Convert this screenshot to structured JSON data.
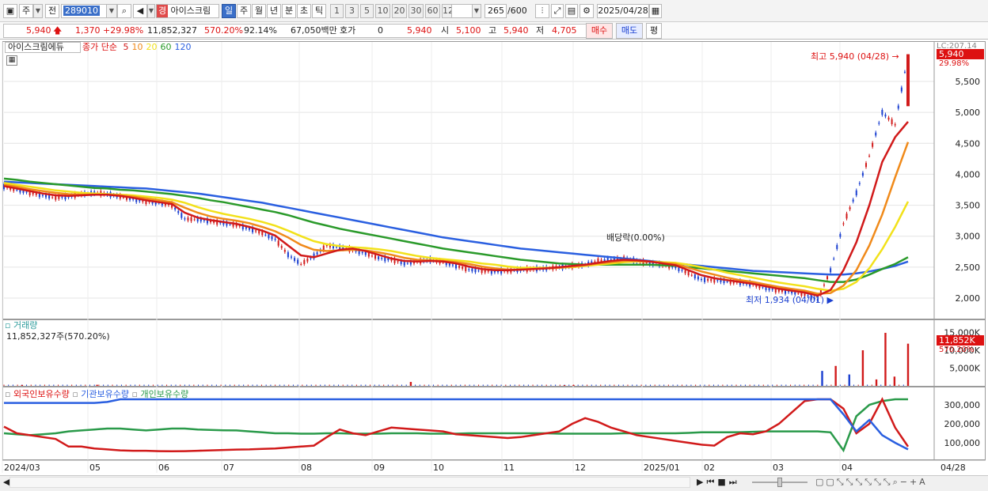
{
  "toolbar": {
    "period_type": "주",
    "compare_label": "전",
    "stock_code": "289010",
    "stock_badge": "경",
    "stock_name": "아이스크림",
    "periods": [
      "일",
      "주",
      "월",
      "년",
      "분",
      "초",
      "틱"
    ],
    "active_period": "일",
    "tick_intervals": [
      "1",
      "3",
      "5",
      "10",
      "20",
      "30",
      "60",
      "120"
    ],
    "count": "265",
    "total": "/600",
    "date": "2025/04/28"
  },
  "quote": {
    "price": "5,940",
    "change": "1,370",
    "change_pct": "+29.98%",
    "volume": "11,852,327",
    "volume_ratio": "570.20%",
    "ratio2": "92.14%",
    "amount": "67,050백만",
    "hoga_label": "호가",
    "hoga_value": "0",
    "hoga_price": "5,940",
    "open_label": "시",
    "open": "5,100",
    "high_label": "고",
    "high": "5,940",
    "low_label": "저",
    "low": "4,705",
    "buy_label": "매수",
    "sell_label": "매도",
    "eval_label": "평"
  },
  "price_panel": {
    "stock_label": "아이스크림에듀",
    "ma_label": "종가 단순",
    "ma_periods": [
      "5",
      "10",
      "20",
      "60",
      "120"
    ],
    "ma_colors": [
      "#d11a1a",
      "#f08a1a",
      "#f2e11a",
      "#2a9a2a",
      "#2a5fe0"
    ],
    "scale_top": "LC:207.14",
    "current_price": "5,940",
    "current_pct": "29.98%",
    "high_note": "최고 5,940 (04/28)",
    "low_note": "최저 1,934 (04/01)",
    "dividend_note": "배당락(0.00%)"
  },
  "volume_panel": {
    "title": "거래량",
    "value": "11,852,327주(570.20%)",
    "current": "11,852K",
    "current_pct": "570.20%"
  },
  "holder_panel": {
    "foreign": "외국인보유수량",
    "institution": "기관보유수량",
    "individual": "개인보유수량"
  },
  "colors": {
    "up": "#d11a1a",
    "down": "#1a3fd0",
    "foreign": "#d11a1a",
    "institution": "#2a5fe0",
    "individual": "#2a9a4a"
  },
  "chart_data": {
    "type": "line",
    "x_labels": [
      "2024/03",
      "05",
      "06",
      "07",
      "08",
      "09",
      "10",
      "11",
      "12",
      "2025/01",
      "02",
      "03",
      "04",
      "04/28"
    ],
    "price_axis": [
      "2,000",
      "2,500",
      "3,000",
      "3,500",
      "4,000",
      "4,500",
      "5,000",
      "5,500"
    ],
    "price_range": [
      1800,
      6200
    ],
    "volume_axis": [
      "5,000K",
      "10,000K",
      "15,000K"
    ],
    "volume_range": [
      0,
      16000
    ],
    "holder_axis": [
      "100,000",
      "200,000",
      "300,000"
    ],
    "holder_range": [
      50000,
      370000
    ],
    "close": [
      3800,
      3750,
      3700,
      3660,
      3620,
      3640,
      3680,
      3700,
      3680,
      3640,
      3600,
      3560,
      3540,
      3500,
      3280,
      3270,
      3240,
      3210,
      3180,
      3120,
      3050,
      2950,
      2700,
      2550,
      2680,
      2850,
      2820,
      2780,
      2720,
      2650,
      2620,
      2560,
      2590,
      2620,
      2580,
      2520,
      2460,
      2440,
      2430,
      2440,
      2460,
      2470,
      2480,
      2500,
      2520,
      2540,
      2600,
      2620,
      2640,
      2600,
      2560,
      2540,
      2500,
      2400,
      2300,
      2290,
      2270,
      2250,
      2220,
      2160,
      2120,
      2100,
      2060,
      1970,
      2450,
      3200,
      3700,
      4300,
      5000,
      4800,
      5940
    ],
    "ma5": [
      3810,
      3770,
      3730,
      3690,
      3660,
      3650,
      3660,
      3670,
      3670,
      3650,
      3620,
      3580,
      3550,
      3520,
      3380,
      3300,
      3260,
      3230,
      3200,
      3150,
      3090,
      3010,
      2850,
      2690,
      2660,
      2720,
      2780,
      2800,
      2760,
      2700,
      2640,
      2600,
      2590,
      2600,
      2590,
      2560,
      2510,
      2470,
      2450,
      2450,
      2460,
      2470,
      2480,
      2500,
      2520,
      2540,
      2570,
      2600,
      2620,
      2610,
      2590,
      2560,
      2530,
      2450,
      2370,
      2320,
      2290,
      2260,
      2230,
      2190,
      2150,
      2120,
      2090,
      2040,
      2130,
      2450,
      2900,
      3500,
      4200,
      4600,
      4850
    ],
    "ma10": [
      3830,
      3800,
      3760,
      3730,
      3700,
      3680,
      3670,
      3670,
      3670,
      3660,
      3640,
      3610,
      3580,
      3550,
      3460,
      3380,
      3320,
      3280,
      3250,
      3210,
      3150,
      3080,
      2980,
      2860,
      2780,
      2760,
      2770,
      2780,
      2770,
      2740,
      2700,
      2650,
      2620,
      2610,
      2600,
      2580,
      2550,
      2510,
      2480,
      2460,
      2460,
      2470,
      2480,
      2490,
      2510,
      2530,
      2560,
      2580,
      2600,
      2600,
      2590,
      2570,
      2550,
      2490,
      2430,
      2380,
      2330,
      2290,
      2260,
      2220,
      2180,
      2150,
      2120,
      2070,
      2080,
      2200,
      2450,
      2850,
      3350,
      3950,
      4520
    ],
    "ma20": [
      3860,
      3830,
      3800,
      3770,
      3740,
      3720,
      3700,
      3690,
      3680,
      3670,
      3660,
      3640,
      3620,
      3590,
      3540,
      3470,
      3410,
      3360,
      3320,
      3280,
      3230,
      3170,
      3090,
      3000,
      2920,
      2870,
      2840,
      2820,
      2810,
      2790,
      2760,
      2720,
      2680,
      2650,
      2630,
      2610,
      2590,
      2560,
      2540,
      2510,
      2490,
      2490,
      2490,
      2490,
      2500,
      2520,
      2540,
      2560,
      2580,
      2590,
      2590,
      2580,
      2570,
      2540,
      2500,
      2460,
      2410,
      2370,
      2330,
      2290,
      2250,
      2220,
      2190,
      2150,
      2120,
      2150,
      2260,
      2480,
      2790,
      3150,
      3560
    ],
    "ma60": [
      3930,
      3910,
      3880,
      3860,
      3840,
      3820,
      3800,
      3780,
      3770,
      3750,
      3740,
      3720,
      3700,
      3680,
      3650,
      3620,
      3580,
      3550,
      3510,
      3470,
      3430,
      3390,
      3340,
      3280,
      3220,
      3170,
      3120,
      3080,
      3040,
      3000,
      2960,
      2920,
      2880,
      2840,
      2800,
      2770,
      2740,
      2710,
      2680,
      2650,
      2620,
      2600,
      2580,
      2560,
      2550,
      2540,
      2540,
      2540,
      2540,
      2540,
      2540,
      2530,
      2520,
      2500,
      2480,
      2460,
      2440,
      2420,
      2400,
      2380,
      2360,
      2340,
      2320,
      2290,
      2260,
      2260,
      2300,
      2380,
      2470,
      2550,
      2660
    ],
    "ma120": [
      3880,
      3870,
      3860,
      3850,
      3840,
      3830,
      3820,
      3810,
      3800,
      3790,
      3780,
      3770,
      3750,
      3730,
      3710,
      3690,
      3660,
      3630,
      3600,
      3570,
      3540,
      3500,
      3460,
      3420,
      3380,
      3340,
      3300,
      3260,
      3220,
      3180,
      3140,
      3100,
      3060,
      3020,
      2980,
      2950,
      2920,
      2890,
      2860,
      2830,
      2800,
      2780,
      2760,
      2740,
      2720,
      2700,
      2680,
      2660,
      2640,
      2620,
      2600,
      2580,
      2560,
      2540,
      2520,
      2500,
      2480,
      2460,
      2440,
      2430,
      2420,
      2410,
      2400,
      2390,
      2380,
      2380,
      2400,
      2430,
      2470,
      2520,
      2590
    ],
    "volume_spikes": [
      {
        "i": 0.02,
        "v": 250
      },
      {
        "i": 0.103,
        "v": 300
      },
      {
        "i": 0.45,
        "v": 1100
      },
      {
        "i": 0.62,
        "v": 200
      },
      {
        "i": 0.63,
        "v": 250
      },
      {
        "i": 0.905,
        "v": 4200
      },
      {
        "i": 0.92,
        "v": 5600
      },
      {
        "i": 0.935,
        "v": 3200
      },
      {
        "i": 0.95,
        "v": 10000
      },
      {
        "i": 0.965,
        "v": 1800
      },
      {
        "i": 0.975,
        "v": 14900
      },
      {
        "i": 0.985,
        "v": 2600
      },
      {
        "i": 1.0,
        "v": 11852
      }
    ],
    "foreign": [
      185000,
      150000,
      140000,
      130000,
      120000,
      80000,
      80000,
      70000,
      65000,
      60000,
      58000,
      58000,
      56000,
      55000,
      56000,
      58000,
      60000,
      62000,
      64000,
      65000,
      68000,
      70000,
      75000,
      80000,
      85000,
      130000,
      170000,
      150000,
      140000,
      160000,
      180000,
      175000,
      170000,
      165000,
      160000,
      145000,
      140000,
      135000,
      130000,
      125000,
      130000,
      140000,
      150000,
      160000,
      200000,
      230000,
      210000,
      180000,
      160000,
      140000,
      130000,
      120000,
      110000,
      100000,
      90000,
      85000,
      130000,
      150000,
      145000,
      160000,
      200000,
      260000,
      320000,
      340000,
      360000,
      280000,
      150000,
      200000,
      330000,
      180000,
      80000
    ],
    "institution": [
      310000,
      310000,
      310000,
      310000,
      310000,
      310000,
      310000,
      310000,
      315000,
      330000,
      335000,
      335000,
      335000,
      335000,
      335000,
      335000,
      335000,
      335000,
      335000,
      335000,
      335000,
      335000,
      335000,
      335000,
      335000,
      335000,
      335000,
      335000,
      335000,
      335000,
      335000,
      335000,
      335000,
      335000,
      335000,
      335000,
      335000,
      335000,
      335000,
      335000,
      335000,
      335000,
      335000,
      345000,
      350000,
      352000,
      355000,
      358000,
      360000,
      362000,
      365000,
      367000,
      370000,
      372000,
      373000,
      373000,
      374000,
      375000,
      375000,
      375000,
      375000,
      375000,
      375000,
      375000,
      375000,
      250000,
      160000,
      220000,
      140000,
      100000,
      65000
    ],
    "individual": [
      150000,
      145000,
      140000,
      145000,
      150000,
      160000,
      165000,
      170000,
      175000,
      175000,
      170000,
      165000,
      170000,
      175000,
      175000,
      170000,
      168000,
      166000,
      165000,
      160000,
      155000,
      150000,
      150000,
      148000,
      148000,
      150000,
      150000,
      148000,
      148000,
      148000,
      150000,
      150000,
      150000,
      148000,
      148000,
      148000,
      150000,
      150000,
      150000,
      150000,
      150000,
      150000,
      150000,
      148000,
      148000,
      148000,
      148000,
      148000,
      150000,
      150000,
      150000,
      150000,
      150000,
      152000,
      155000,
      155000,
      155000,
      156000,
      158000,
      160000,
      160000,
      160000,
      160000,
      160000,
      155000,
      60000,
      240000,
      300000,
      320000,
      360000,
      380000
    ]
  }
}
